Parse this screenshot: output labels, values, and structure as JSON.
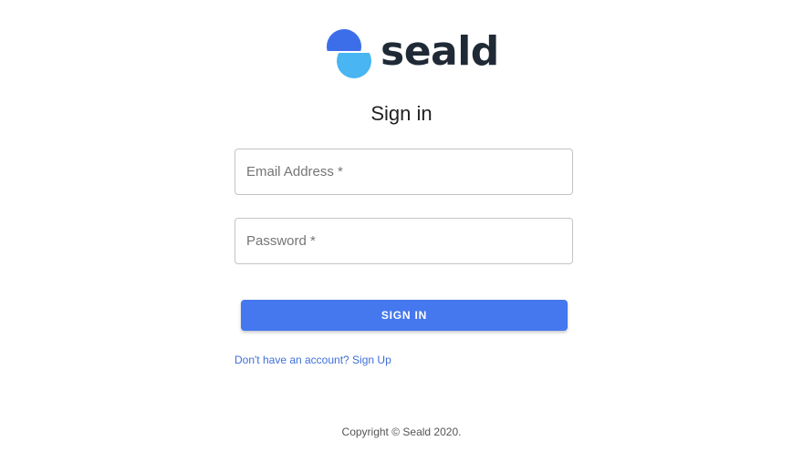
{
  "brand": {
    "name": "seald",
    "logo_icon": "seald-logo-icon",
    "colors": {
      "logo_top": "#3d6ee9",
      "logo_bottom": "#49b5f2",
      "wordmark": "#1f2a36"
    }
  },
  "form": {
    "title": "Sign in",
    "email_placeholder": "Email Address *",
    "password_placeholder": "Password *",
    "submit_label": "SIGN IN",
    "signup_link": "Don't have an account? Sign Up"
  },
  "footer": {
    "copyright": "Copyright © Seald 2020."
  },
  "colors": {
    "primary": "#4577ee",
    "link": "#3f6fd9"
  }
}
